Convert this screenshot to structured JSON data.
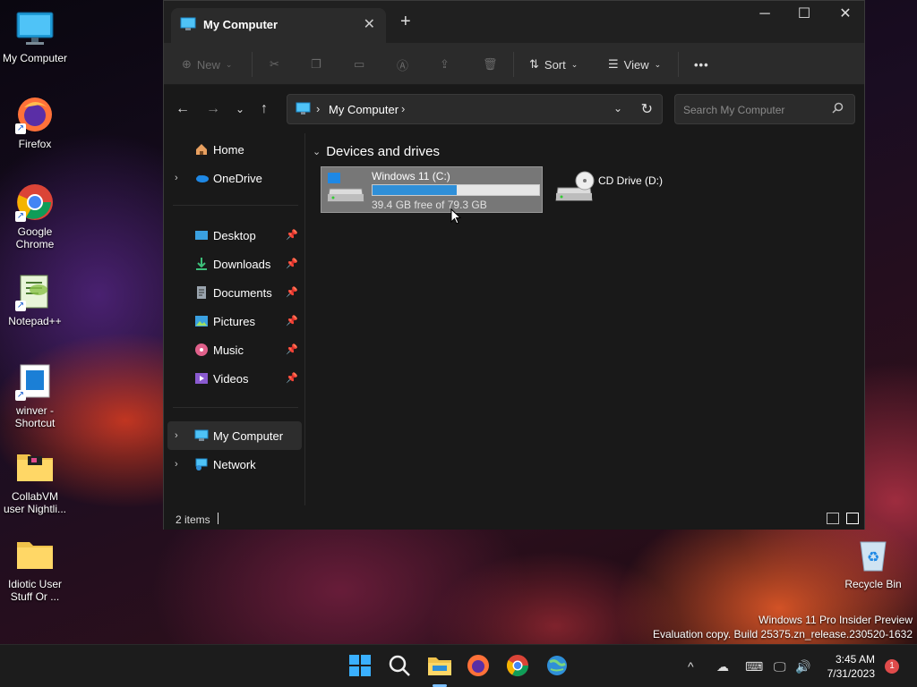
{
  "desktop": {
    "icons": [
      {
        "label": "My Computer"
      },
      {
        "label": "Firefox"
      },
      {
        "label": "Google Chrome"
      },
      {
        "label": "Notepad++"
      },
      {
        "label": "winver - Shortcut"
      },
      {
        "label": "CollabVM user Nightli..."
      },
      {
        "label": "Idiotic User Stuff Or ..."
      },
      {
        "label": "Recycle Bin"
      }
    ],
    "watermark_line1": "Windows 11 Pro Insider Preview",
    "watermark_line2": "Evaluation copy. Build 25375.zn_release.230520-1632"
  },
  "window": {
    "tab_title": "My Computer",
    "toolbar": {
      "new_label": "New",
      "sort_label": "Sort",
      "view_label": "View",
      "more_label": "•••"
    },
    "address": {
      "crumb": "My Computer"
    },
    "search": {
      "placeholder": "Search My Computer"
    },
    "sidebar": {
      "items": [
        {
          "label": "Home"
        },
        {
          "label": "OneDrive"
        },
        {
          "label": "Desktop"
        },
        {
          "label": "Downloads"
        },
        {
          "label": "Documents"
        },
        {
          "label": "Pictures"
        },
        {
          "label": "Music"
        },
        {
          "label": "Videos"
        },
        {
          "label": "My Computer"
        },
        {
          "label": "Network"
        }
      ]
    },
    "content": {
      "group_title": "Devices and drives",
      "drives": [
        {
          "label": "Windows 11 (C:)",
          "free_text": "39.4 GB free of 79.3 GB",
          "used_fraction": 0.503
        },
        {
          "label": "CD Drive (D:)"
        }
      ]
    },
    "status": {
      "items_count": "2 items"
    }
  },
  "taskbar": {
    "time": "3:45 AM",
    "date": "7/31/2023",
    "notification_count": "1"
  },
  "colors": {
    "accent": "#2f8fd8",
    "window_bg": "#191919",
    "taskbar_bg": "#1c1c1c"
  }
}
